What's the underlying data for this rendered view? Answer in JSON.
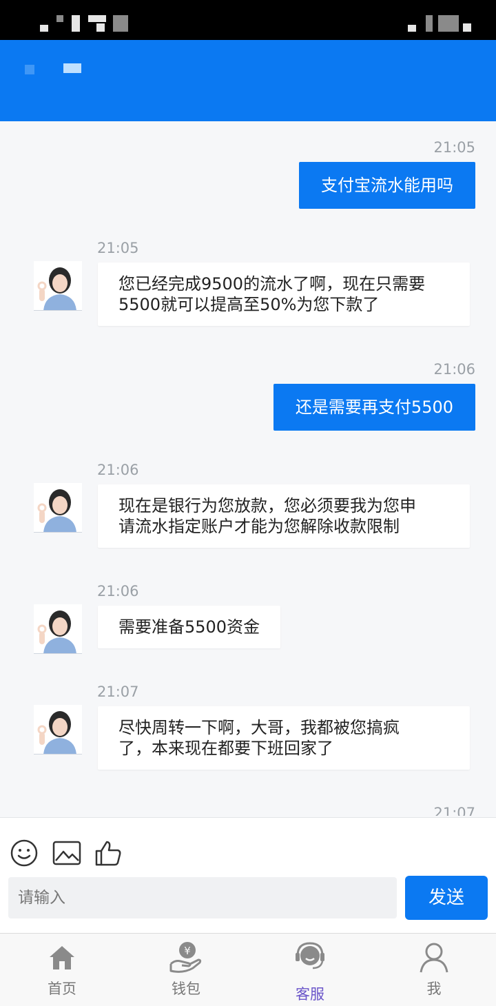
{
  "chat": {
    "messages": [
      {
        "side": "out",
        "time": "21:05",
        "text": "支付宝流水能用吗"
      },
      {
        "side": "in",
        "time": "21:05",
        "lines": [
          "您已经完成9500的流水了啊，现在只需要",
          "5500就可以提高至50%为您下款了"
        ]
      },
      {
        "side": "out",
        "time": "21:06",
        "text": "还是需要再支付5500"
      },
      {
        "side": "in",
        "time": "21:06",
        "lines": [
          "现在是银行为您放款，您必须要我为您申",
          "请流水指定账户才能为您解除收款限制"
        ]
      },
      {
        "side": "in",
        "time": "21:06",
        "lines": [
          "需要准备5500资金"
        ]
      },
      {
        "side": "in",
        "time": "21:07",
        "lines": [
          "尽快周转一下啊，大哥，我都被您搞疯",
          "了，本来现在都要下班回家了"
        ]
      }
    ],
    "partial_timestamp": "21:07"
  },
  "toolbar": {
    "icons": [
      "smiley-icon",
      "image-icon",
      "thumbs-up-icon"
    ]
  },
  "input": {
    "placeholder": "请输入",
    "send_label": "发送"
  },
  "nav": {
    "items": [
      {
        "label": "首页",
        "icon": "home-icon"
      },
      {
        "label": "钱包",
        "icon": "wallet-icon"
      },
      {
        "label": "客服",
        "icon": "customer-service-icon",
        "active": true
      },
      {
        "label": "我",
        "icon": "profile-icon"
      }
    ]
  },
  "colors": {
    "brand_blue": "#0b79f2",
    "active_nav": "#6a55c9"
  }
}
